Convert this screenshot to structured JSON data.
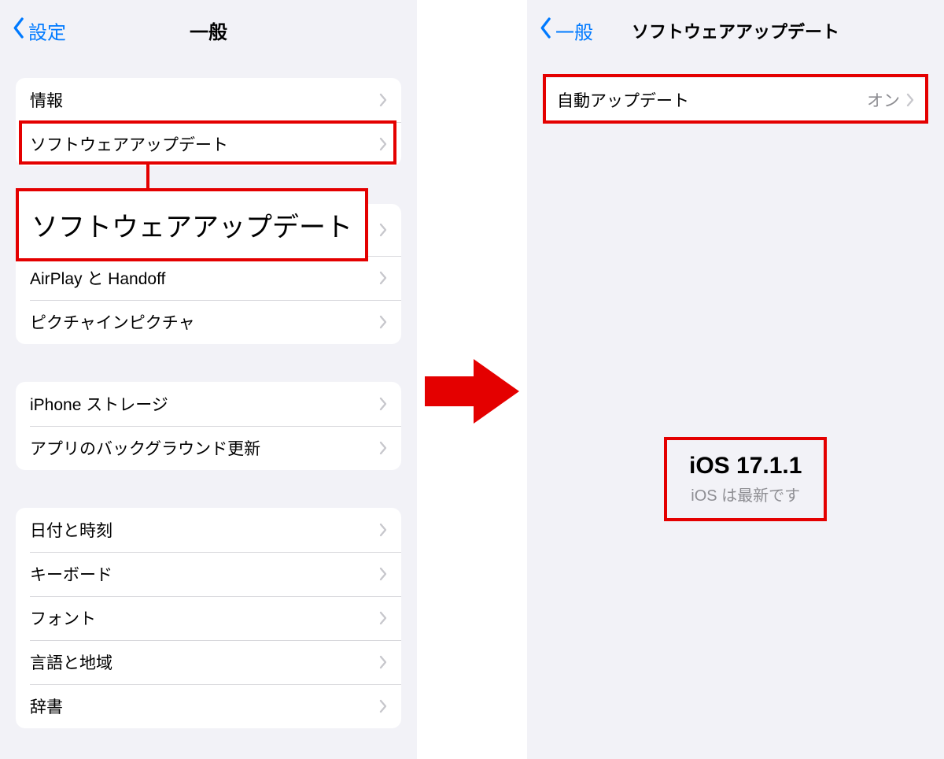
{
  "left": {
    "back": "設定",
    "title": "一般",
    "g1": {
      "about": "情報",
      "sw": "ソフトウェアアップデート"
    },
    "callout": "ソフトウェアアップデート",
    "g2": {
      "airplay": "AirPlay と Handoff",
      "pip": "ピクチャインピクチャ"
    },
    "g3": {
      "storage": "iPhone ストレージ",
      "bg": "アプリのバックグラウンド更新"
    },
    "g4": {
      "datetime": "日付と時刻",
      "keyboard": "キーボード",
      "font": "フォント",
      "lang": "言語と地域",
      "dict": "辞書"
    }
  },
  "right": {
    "back": "一般",
    "title": "ソフトウェアアップデート",
    "auto": {
      "label": "自動アップデート",
      "value": "オン"
    },
    "status": {
      "version": "iOS 17.1.1",
      "message": "iOS は最新です"
    }
  }
}
